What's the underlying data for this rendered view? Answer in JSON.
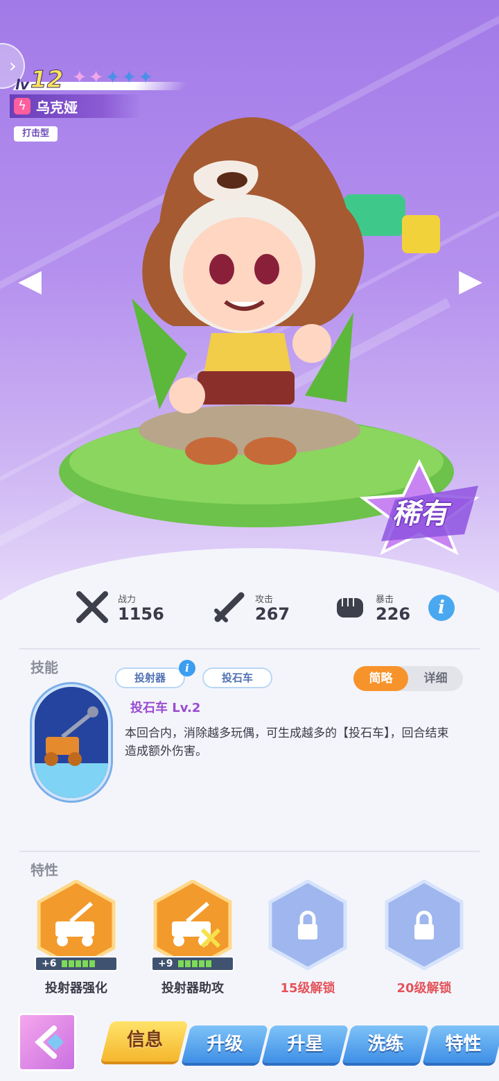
{
  "hero": {
    "level_prefix": "lv",
    "level": "12",
    "stars": [
      {
        "color": "pink",
        "filled": true
      },
      {
        "color": "pink",
        "filled": true
      },
      {
        "color": "blue",
        "filled": true
      },
      {
        "color": "blue",
        "filled": true
      },
      {
        "color": "blue",
        "filled": true
      }
    ],
    "name": "乌克娅",
    "type": "打击型",
    "rarity": "稀有"
  },
  "stats": [
    {
      "label": "战力",
      "value": "1156",
      "icon": "crossed-swords-icon"
    },
    {
      "label": "攻击",
      "value": "267",
      "icon": "sword-icon"
    },
    {
      "label": "暴击",
      "value": "226",
      "icon": "fist-icon"
    }
  ],
  "skill": {
    "section_title": "技能",
    "chips": [
      "投射器",
      "投石车"
    ],
    "toggle": {
      "brief": "简略",
      "detail": "详细",
      "selected": "简略"
    },
    "name": "投石车 Lv.2",
    "description": "本回合内，消除越多玩偶，可生成越多的【投石车】，回合结束造成额外伤害。"
  },
  "traits": {
    "section_title": "特性",
    "items": [
      {
        "label": "投射器强化",
        "plus": "+6",
        "locked": false
      },
      {
        "label": "投射器助攻",
        "plus": "+9",
        "locked": false
      },
      {
        "label": "15级解锁",
        "locked": true
      },
      {
        "label": "20级解锁",
        "locked": true
      }
    ]
  },
  "tabs": [
    "信息",
    "升级",
    "升星",
    "洗练",
    "特性"
  ],
  "active_tab": "信息",
  "colors": {
    "accent_orange": "#f7932b",
    "rarity_purple": "#9a4cd1",
    "tab_blue": "#3f8fe6",
    "tab_active_yellow": "#f5b62d",
    "lock_text_red": "#e2545a"
  }
}
